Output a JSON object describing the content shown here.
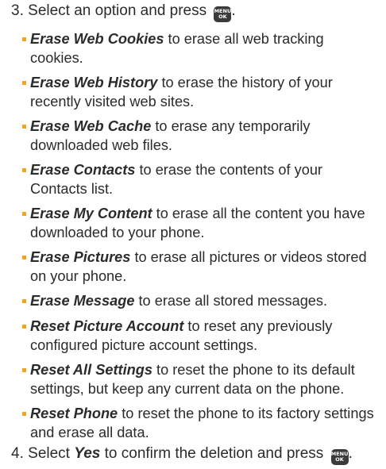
{
  "step3": {
    "number": "3.",
    "text": "Select an option and press",
    "key_top": "MENU",
    "key_bottom": "OK",
    "end": "."
  },
  "items": [
    {
      "term": "Erase Web Cookies",
      "desc": " to erase all web tracking cookies."
    },
    {
      "term": "Erase Web History",
      "desc": " to erase the history of your recently visited web sites."
    },
    {
      "term": "Erase Web Cache",
      "desc": " to erase any temporarily downloaded web files."
    },
    {
      "term": "Erase Contacts",
      "desc": " to erase the contents of your Contacts list."
    },
    {
      "term": "Erase My Content",
      "desc": " to erase all the content you have downloaded to your phone."
    },
    {
      "term": "Erase Pictures",
      "desc": " to erase all pictures or videos stored on your phone."
    },
    {
      "term": "Erase Message",
      "desc": " to erase all stored messages."
    },
    {
      "term": "Reset Picture Account",
      "desc": " to reset any previously configured picture account settings."
    },
    {
      "term": "Reset All Settings",
      "desc": " to reset the phone to its default settings, but keep any current data on the phone."
    },
    {
      "term": "Reset Phone",
      "desc": " to reset the phone to its factory settings and erase all data."
    }
  ],
  "step4": {
    "number": "4.",
    "before": "Select ",
    "term": "Yes",
    "after": " to confirm the deletion and press",
    "key_top": "MENU",
    "key_bottom": "OK",
    "end": "."
  }
}
